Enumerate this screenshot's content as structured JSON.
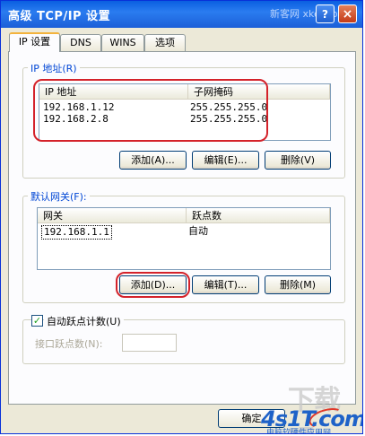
{
  "window": {
    "title": "高级 TCP/IP 设置",
    "watermark_text": "新客网 xker.com",
    "help_glyph": "?",
    "close_glyph": "×"
  },
  "tabs": [
    {
      "label": "IP 设置",
      "active": true
    },
    {
      "label": "DNS",
      "active": false
    },
    {
      "label": "WINS",
      "active": false
    },
    {
      "label": "选项",
      "active": false
    }
  ],
  "ip_section": {
    "label": "IP 地址(R)",
    "columns": [
      "IP 地址",
      "子网掩码"
    ],
    "rows": [
      {
        "ip": "192.168.1.12",
        "mask": "255.255.255.0"
      },
      {
        "ip": "192.168.2.8",
        "mask": "255.255.255.0"
      }
    ],
    "add": "添加(A)...",
    "edit": "编辑(E)...",
    "delete": "删除(V)"
  },
  "gateway_section": {
    "label": "默认网关(F):",
    "columns": [
      "网关",
      "跃点数"
    ],
    "rows": [
      {
        "gateway": "192.168.1.1",
        "metric": "自动"
      }
    ],
    "add": "添加(D)...",
    "edit": "编辑(T)...",
    "delete": "删除(M)"
  },
  "metric": {
    "auto_label": "自动跃点计数(U)",
    "auto_checked": true,
    "interface_label": "接口跃点数(N):",
    "interface_value": ""
  },
  "footer": {
    "ok": "确定"
  },
  "watermarks": {
    "big": "下载吧",
    "logo": "4s1T.com",
    "logo_sub": "电脑软硬件应用网"
  },
  "colors": {
    "highlight": "#d4222a",
    "titlebar": "#0a5fe0"
  }
}
